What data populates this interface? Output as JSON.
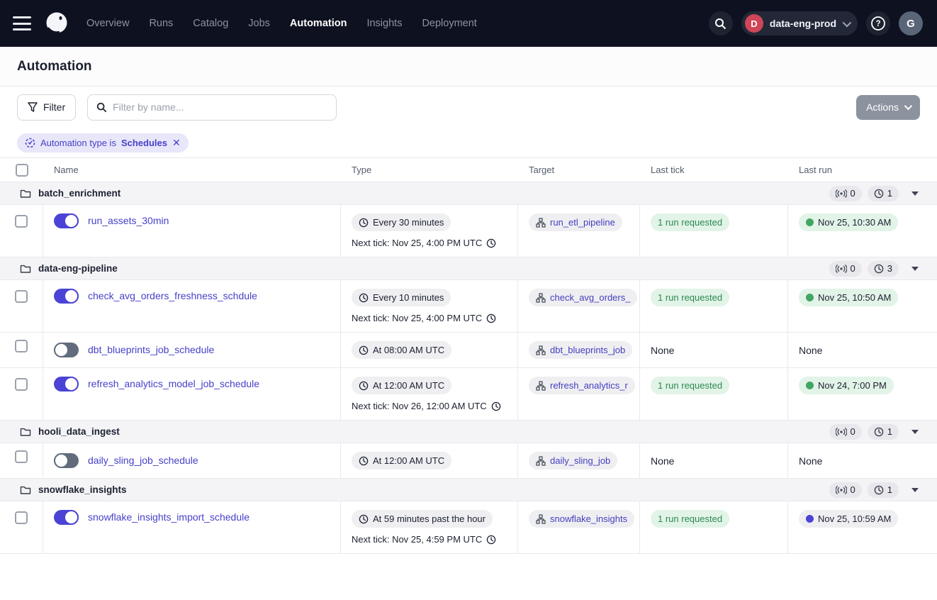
{
  "nav": {
    "items": [
      {
        "label": "Overview"
      },
      {
        "label": "Runs"
      },
      {
        "label": "Catalog"
      },
      {
        "label": "Jobs"
      },
      {
        "label": "Automation"
      },
      {
        "label": "Insights"
      },
      {
        "label": "Deployment"
      }
    ],
    "deployment": {
      "initial": "D",
      "name": "data-eng-prod"
    },
    "avatar_initial": "G"
  },
  "page": {
    "title": "Automation"
  },
  "toolbar": {
    "filter_label": "Filter",
    "search_placeholder": "Filter by name...",
    "actions_label": "Actions"
  },
  "filter_chip": {
    "prefix": "Automation type is",
    "value": "Schedules",
    "close": "✕"
  },
  "table": {
    "headers": [
      "Name",
      "Type",
      "Target",
      "Last tick",
      "Last run"
    ]
  },
  "groups": [
    {
      "name": "batch_enrichment",
      "sensor_count": "0",
      "schedule_count": "1",
      "rows": [
        {
          "name": "run_assets_30min",
          "enabled": true,
          "type": "Every 30 minutes",
          "next_tick": "Next tick: Nov 25, 4:00 PM UTC",
          "target": "run_etl_pipeline",
          "last_tick": "1 run requested",
          "last_run": "Nov 25, 10:30 AM",
          "last_run_status": "success"
        }
      ]
    },
    {
      "name": "data-eng-pipeline",
      "sensor_count": "0",
      "schedule_count": "3",
      "rows": [
        {
          "name": "check_avg_orders_freshness_schdule",
          "enabled": true,
          "type": "Every 10 minutes",
          "next_tick": "Next tick: Nov 25, 4:00 PM UTC",
          "target": "check_avg_orders_",
          "last_tick": "1 run requested",
          "last_run": "Nov 25, 10:50 AM",
          "last_run_status": "success"
        },
        {
          "name": "dbt_blueprints_job_schedule",
          "enabled": false,
          "type": "At 08:00 AM UTC",
          "target": "dbt_blueprints_job",
          "last_tick": "None",
          "last_run": "None"
        },
        {
          "name": "refresh_analytics_model_job_schedule",
          "enabled": true,
          "type": "At 12:00 AM UTC",
          "next_tick": "Next tick: Nov 26, 12:00 AM UTC",
          "target": "refresh_analytics_r",
          "last_tick": "1 run requested",
          "last_run": "Nov 24, 7:00 PM",
          "last_run_status": "success"
        }
      ]
    },
    {
      "name": "hooli_data_ingest",
      "sensor_count": "0",
      "schedule_count": "1",
      "rows": [
        {
          "name": "daily_sling_job_schedule",
          "enabled": false,
          "type": "At 12:00 AM UTC",
          "target": "daily_sling_job",
          "last_tick": "None",
          "last_run": "None"
        }
      ]
    },
    {
      "name": "snowflake_insights",
      "sensor_count": "0",
      "schedule_count": "1",
      "rows": [
        {
          "name": "snowflake_insights_import_schedule",
          "enabled": true,
          "type": "At 59 minutes past the hour",
          "next_tick": "Next tick: Nov 25, 4:59 PM UTC",
          "target": "snowflake_insights",
          "last_tick": "1 run requested",
          "last_run": "Nov 25, 10:59 AM",
          "last_run_status": "in_progress"
        }
      ]
    }
  ],
  "colors": {
    "accent": "#4B43D6",
    "nav_bg": "#0D1120",
    "success_green": "#43A564",
    "deployment_red": "#CE4657",
    "chip_bg": "#E8E6F9",
    "group_bg": "#F4F4F7"
  }
}
